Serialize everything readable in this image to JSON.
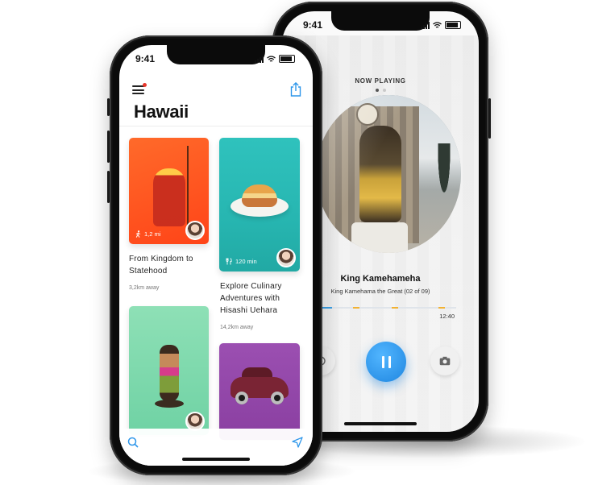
{
  "back_phone": {
    "status_time": "9:41",
    "now_playing_label": "NOW PLAYING",
    "track": {
      "title": "King Kamehameha",
      "subtitle": "King Kamehama the Great (02 of 09)",
      "duration": "12:40",
      "progress_fraction": 0.18
    },
    "controls": {
      "left_icon": "clock-icon",
      "play_pause_icon": "pause-icon",
      "right_icon": "camera-icon"
    },
    "colors": {
      "accent": "#2d96ea",
      "marker": "#f2b233"
    }
  },
  "front_phone": {
    "status_time": "9:41",
    "title": "Hawaii",
    "cards": [
      {
        "title_lines": [
          "From Kingdom to",
          "Statehood"
        ],
        "meta_icon": "walking-icon",
        "meta": "1,2 mi",
        "distance": "3,2km away",
        "color": "#ff5a22"
      },
      {
        "title_lines": [
          "Explore Culinary",
          "Adventures with",
          "Hisashi Uehara"
        ],
        "meta_icon": "fork-knife-icon",
        "meta": "120 min",
        "distance": "14,2km away",
        "color": "#2bbab5"
      },
      {
        "color": "#7fd9ad"
      },
      {
        "color": "#9347ab"
      }
    ],
    "icons": {
      "menu": "menu-icon",
      "share": "share-icon",
      "search": "search-icon",
      "navigate": "navigation-arrow-icon"
    },
    "colors": {
      "accent": "#2d96ea",
      "notification": "#e8372c"
    }
  }
}
